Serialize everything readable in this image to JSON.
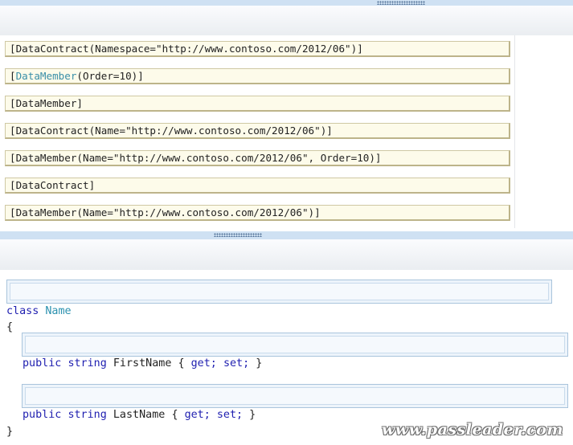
{
  "answer_choices": [
    {
      "prefix": "[",
      "keyword": "",
      "text": "DataContract(Namespace=\"http://www.contoso.com/2012/06\")]"
    },
    {
      "prefix": "[",
      "keyword": "DataMember",
      "text": "(Order=10)]"
    },
    {
      "prefix": "[",
      "keyword": "",
      "text": "DataMember]"
    },
    {
      "prefix": "[",
      "keyword": "",
      "text": "DataContract(Name=\"http://www.contoso.com/2012/06\")]"
    },
    {
      "prefix": "[",
      "keyword": "",
      "text": "DataMember(Name=\"http://www.contoso.com/2012/06\", Order=10)]"
    },
    {
      "prefix": "[",
      "keyword": "",
      "text": "DataContract]"
    },
    {
      "prefix": "[",
      "keyword": "",
      "text": "DataMember(Name=\"http://www.contoso.com/2012/06\")]"
    }
  ],
  "code": {
    "class_keyword": "class",
    "class_name": "Name",
    "open_brace": "{",
    "close_brace": "}",
    "first_member": {
      "access": "public",
      "type": "string",
      "name": "FirstName",
      "accessors_open": "{ ",
      "get": "get;",
      "set": "set;",
      "accessors_close": " }"
    },
    "second_member": {
      "access": "public",
      "type": "string",
      "name": "LastName",
      "accessors_open": "{ ",
      "get": "get;",
      "set": "set;",
      "accessors_close": " }"
    }
  },
  "watermark": "www.passleader.com",
  "colors": {
    "splitter": "#cfe1f3",
    "item_background": "#fdfbea",
    "drop_target": "#edf4fb",
    "keyword": "#1f1fb0",
    "type_name": "#2b91af"
  }
}
